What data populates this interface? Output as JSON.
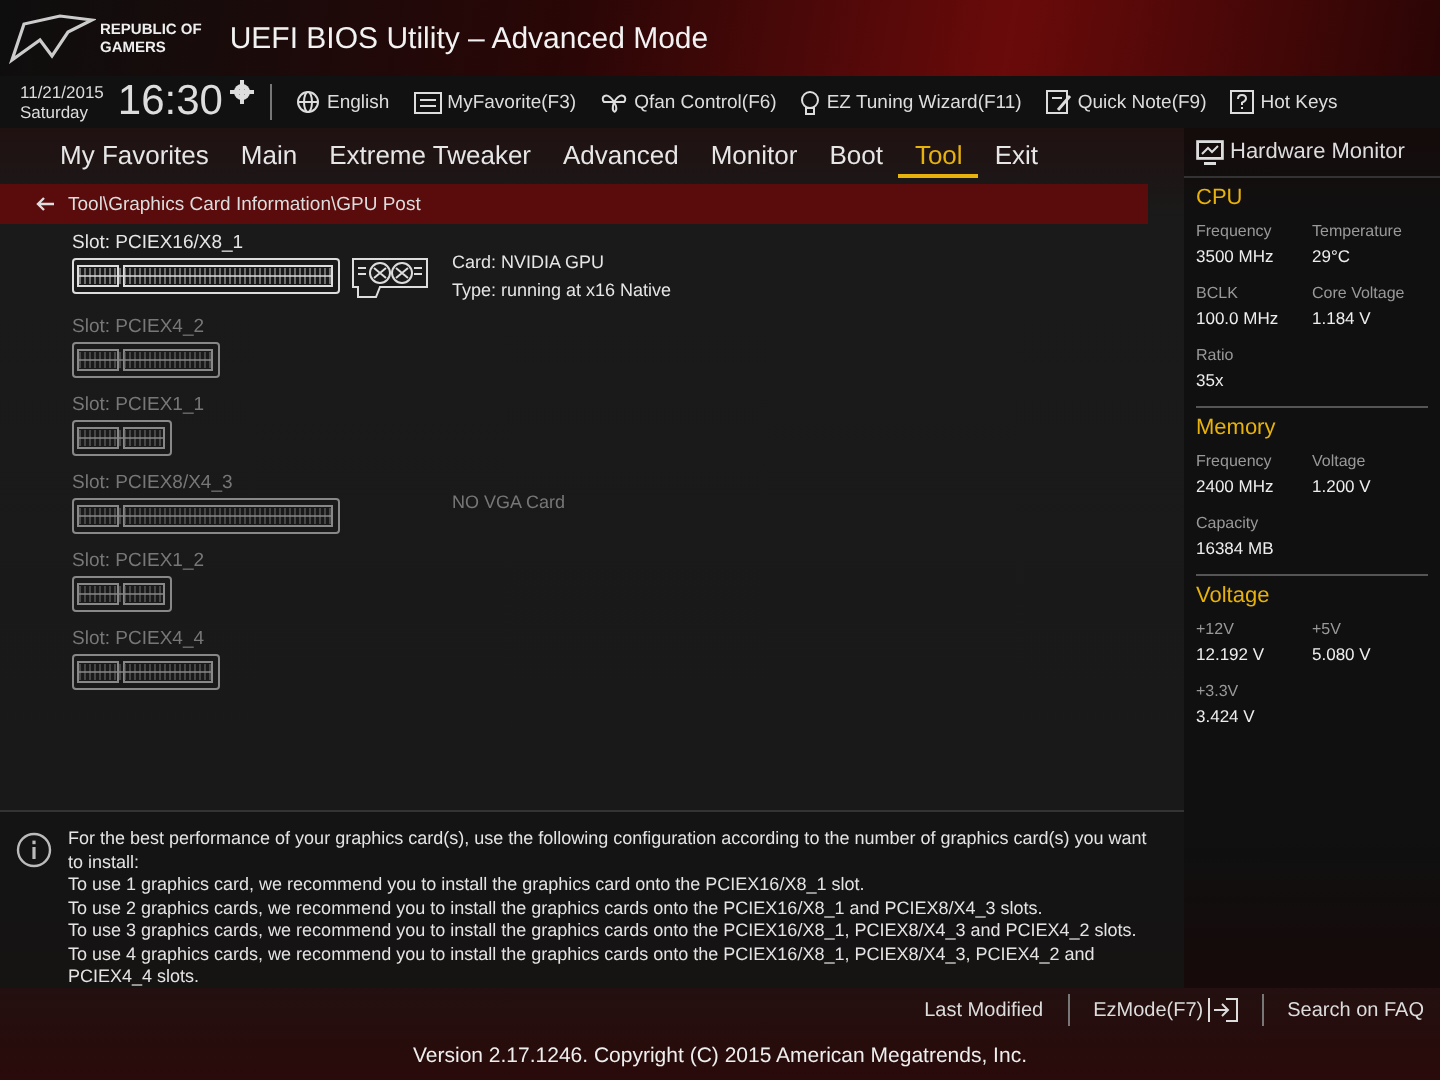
{
  "brand": {
    "line1": "REPUBLIC OF",
    "line2": "GAMERS"
  },
  "window": {
    "title": "UEFI BIOS Utility – Advanced Mode"
  },
  "clock": {
    "date": "11/21/2015",
    "day": "Saturday",
    "time": "16:30"
  },
  "toolbar": [
    {
      "kind": "globe",
      "label": "English"
    },
    {
      "kind": "favorite",
      "label": "MyFavorite(F3)"
    },
    {
      "kind": "fan",
      "label": "Qfan Control(F6)"
    },
    {
      "kind": "bulb",
      "label": "EZ Tuning Wizard(F11)"
    },
    {
      "kind": "note",
      "label": "Quick Note(F9)"
    },
    {
      "kind": "help",
      "label": "Hot Keys"
    }
  ],
  "tabs": [
    {
      "label": "My Favorites",
      "selected": false
    },
    {
      "label": "Main",
      "selected": false
    },
    {
      "label": "Extreme Tweaker",
      "selected": false
    },
    {
      "label": "Advanced",
      "selected": false
    },
    {
      "label": "Monitor",
      "selected": false
    },
    {
      "label": "Boot",
      "selected": false
    },
    {
      "label": "Tool",
      "selected": true
    },
    {
      "label": "Exit",
      "selected": false
    }
  ],
  "breadcrumb": "Tool\\Graphics Card Information\\GPU Post",
  "slots": [
    {
      "label": "Slot: PCIEX16/X8_1",
      "kind": "long",
      "installed": true,
      "info": [
        "Card: NVIDIA GPU",
        "Type: running at x16 Native"
      ]
    },
    {
      "label": "Slot: PCIEX4_2",
      "kind": "medium",
      "installed": false
    },
    {
      "label": "Slot: PCIEX1_1",
      "kind": "short",
      "installed": false
    },
    {
      "label": "Slot: PCIEX8/X4_3",
      "kind": "long",
      "installed": false,
      "info": [
        "NO VGA Card"
      ]
    },
    {
      "label": "Slot: PCIEX1_2",
      "kind": "short",
      "installed": false
    },
    {
      "label": "Slot: PCIEX4_4",
      "kind": "medium",
      "installed": false
    }
  ],
  "hardware_monitor": {
    "title": "Hardware Monitor",
    "sections": [
      {
        "title": "CPU",
        "items": [
          {
            "label": "Frequency",
            "value": "3500 MHz"
          },
          {
            "label": "Temperature",
            "value": "29°C"
          },
          {
            "label": "BCLK",
            "value": "100.0 MHz"
          },
          {
            "label": "Core Voltage",
            "value": "1.184 V"
          },
          {
            "label": "Ratio",
            "value": "35x"
          }
        ]
      },
      {
        "title": "Memory",
        "items": [
          {
            "label": "Frequency",
            "value": "2400 MHz"
          },
          {
            "label": "Voltage",
            "value": "1.200 V"
          },
          {
            "label": "Capacity",
            "value": "16384 MB"
          }
        ]
      },
      {
        "title": "Voltage",
        "items": [
          {
            "label": "+12V",
            "value": "12.192 V"
          },
          {
            "label": "+5V",
            "value": "5.080 V"
          },
          {
            "label": "+3.3V",
            "value": "3.424 V"
          }
        ]
      }
    ]
  },
  "help": [
    "For the best performance of your graphics card(s), use the following configuration according to the number of graphics card(s) you want to install:",
    "To use 1 graphics card, we recommend you to install  the graphics card onto the PCIEX16/X8_1 slot.",
    "To use 2 graphics cards, we recommend you to install the graphics cards onto the PCIEX16/X8_1 and PCIEX8/X4_3 slots.",
    "To use 3 graphics cards, we recommend you to install the graphics cards onto the PCIEX16/X8_1, PCIEX8/X4_3 and PCIEX4_2 slots.",
    "To use 4 graphics cards, we recommend you to install the graphics cards onto the PCIEX16/X8_1, PCIEX8/X4_3, PCIEX4_2 and PCIEX4_4 slots."
  ],
  "footer_links": [
    {
      "label": "Last Modified",
      "icon": false
    },
    {
      "label": "EzMode(F7)",
      "icon": true
    },
    {
      "label": "Search on FAQ",
      "icon": false
    }
  ],
  "version": "Version 2.17.1246. Copyright (C) 2015 American Megatrends, Inc."
}
